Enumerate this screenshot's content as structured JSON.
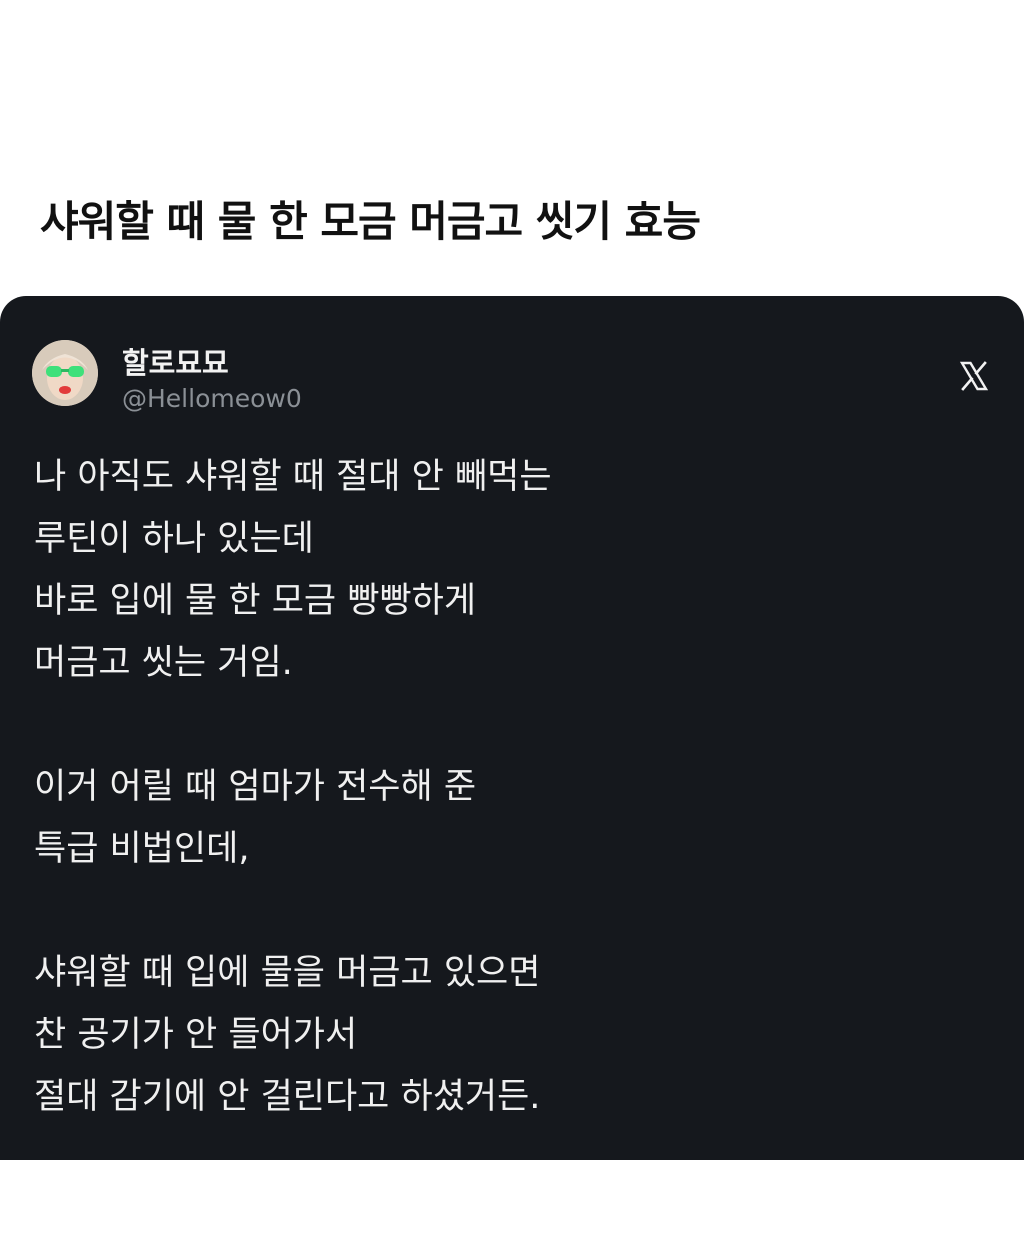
{
  "headline": "샤워할 때 물 한 모금 머금고 씻기 효능",
  "tweet": {
    "author": {
      "display_name": "할로묘묘",
      "handle": "@Hellomeow0",
      "avatar_icon": "avatar-green-sunglasses"
    },
    "platform_icon": "x-logo-icon",
    "paragraphs": [
      {
        "lines": [
          "나 아직도 샤워할 때 절대 안 빼먹는",
          "루틴이 하나 있는데",
          "바로 입에 물 한 모금 빵빵하게",
          "머금고 씻는 거임."
        ]
      },
      {
        "lines": [
          "이거 어릴 때 엄마가 전수해 준",
          "특급 비법인데,"
        ]
      },
      {
        "lines": [
          "샤워할 때 입에 물을 머금고 있으면",
          "찬 공기가 안 들어가서",
          "절대 감기에 안 걸린다고 하셨거든."
        ]
      }
    ]
  },
  "colors": {
    "card_background": "#15181d",
    "text": "#f0f0f0",
    "handle": "#8b9096"
  }
}
